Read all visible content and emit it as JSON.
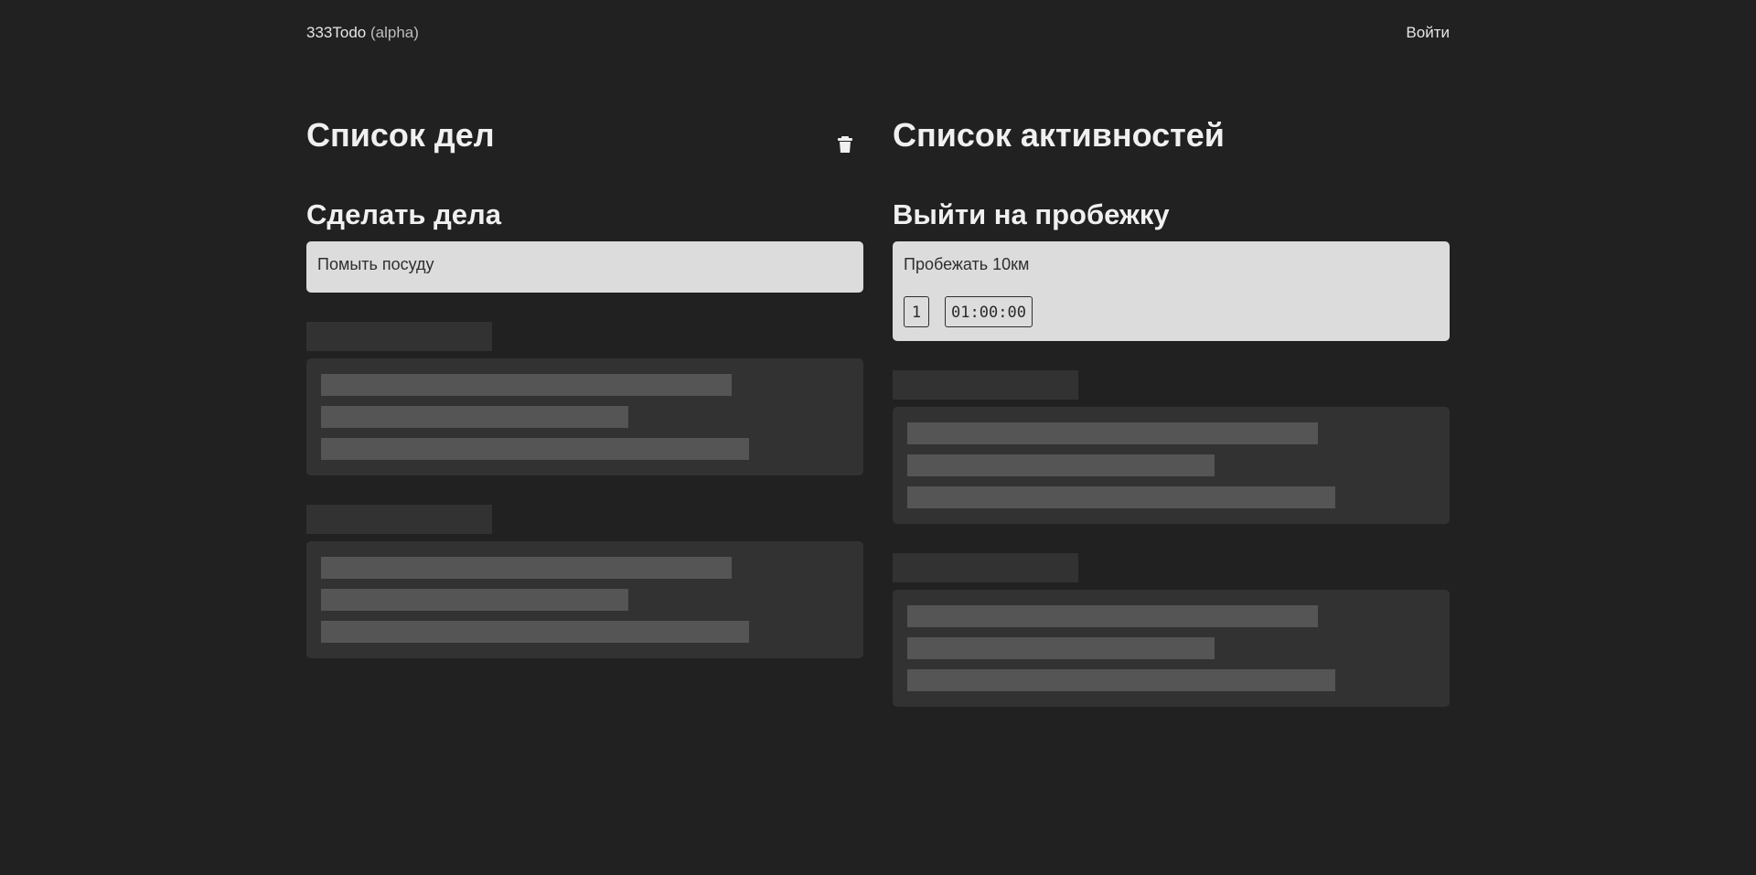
{
  "header": {
    "brand_name": "333Todo",
    "brand_tag": "(alpha)",
    "login_label": "Войти"
  },
  "todo_column": {
    "title": "Список дел",
    "trash_icon": "trash-icon",
    "section_title": "Сделать дела",
    "item_text": "Помыть посуду"
  },
  "activity_column": {
    "title": "Список активностей",
    "section_title": "Выйти на пробежку",
    "item_text": "Пробежать 10км",
    "count": "1",
    "duration": "01:00:00"
  },
  "colors": {
    "background": "#212121",
    "card": "#dcdcdc",
    "skeleton_block": "#323232",
    "skeleton_line": "#555555"
  }
}
